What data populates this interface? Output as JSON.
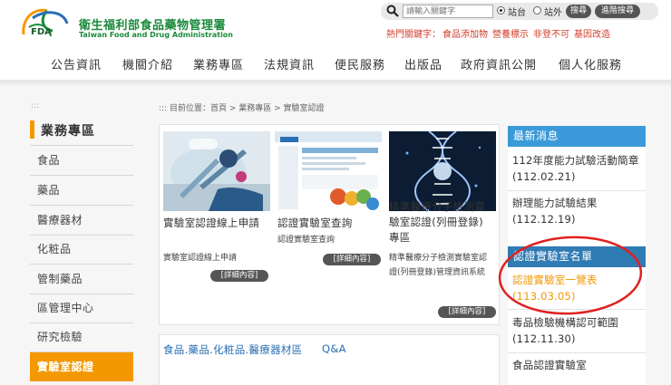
{
  "header": {
    "logo_cn": "衛生福利部食品藥物管理署",
    "logo_en": "Taiwan Food and Drug Administration",
    "logo_mark": "FDA",
    "search_placeholder": "請輸入關鍵字",
    "radio_site": "站台",
    "radio_external": "站外",
    "search_button": "搜尋",
    "advanced_search_button": "進階搜尋",
    "hot_keywords_label": "熱門關鍵字：",
    "hot_keywords": [
      "食品添加物",
      "營養標示",
      "非登不可",
      "基因改造"
    ]
  },
  "nav": [
    "公告資訊",
    "機關介紹",
    "業務專區",
    "法規資訊",
    "便民服務",
    "出版品",
    "政府資訊公開",
    "個人化服務"
  ],
  "sidebar": {
    "dots": ":::",
    "title": "業務專區",
    "items": [
      {
        "label": "食品",
        "active": false
      },
      {
        "label": "藥品",
        "active": false
      },
      {
        "label": "醫療器材",
        "active": false
      },
      {
        "label": "化粧品",
        "active": false
      },
      {
        "label": "管制藥品",
        "active": false
      },
      {
        "label": "區管理中心",
        "active": false
      },
      {
        "label": "研究檢驗",
        "active": false
      },
      {
        "label": "實驗室認證",
        "active": true
      }
    ]
  },
  "breadcrumb": ":::  目前位置：首頁 > 業務專區 > 實驗室認證",
  "cards": [
    {
      "title": "實驗室認證線上申請",
      "desc": "實驗室認證線上申請",
      "button": "[詳細內容]"
    },
    {
      "title": "認證實驗室查詢",
      "desc": "認證實驗室查詢",
      "button": "[詳細內容]"
    },
    {
      "title": "精準醫療分子檢測實驗室認證(列冊登錄) 專區",
      "desc": "精準醫療分子檢測實驗室認證(列冊登錄)管理資訊系統",
      "button": "[詳細內容]"
    }
  ],
  "qa": {
    "text": "食品.藥品.化粧品.醫療器材區",
    "link": "Q&A"
  },
  "news": {
    "title": "最新消息",
    "items": [
      "112年度能力試驗活動簡章(112.02.21)",
      "辦理能力試驗結果(112.12.19)"
    ]
  },
  "cert": {
    "title": "認證實驗室名單",
    "items": [
      "認證實驗室一覽表(113.03.05)",
      "毒品檢驗機構認可範圍(112.11.30)",
      "食品認證實驗室"
    ]
  },
  "colors": {
    "brand_green": "#1a8a3a",
    "accent_orange": "#f39800",
    "news_blue": "#3a9ad9",
    "highlight_red": "#e02020"
  }
}
